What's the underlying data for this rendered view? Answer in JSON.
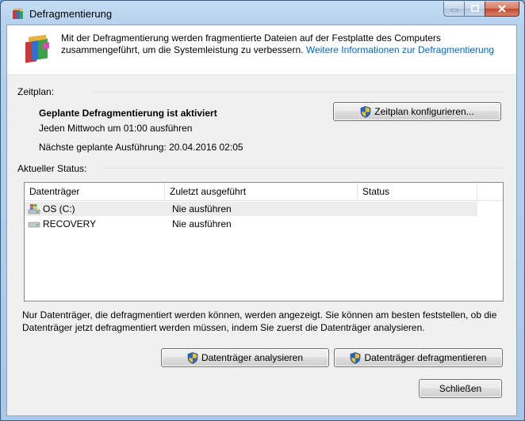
{
  "window": {
    "title": "Defragmentierung"
  },
  "intro": {
    "text": "Mit der Defragmentierung werden fragmentierte Dateien auf der Festplatte des Computers zusammengeführt, um die Systemleistung zu verbessern.",
    "link": "Weitere Informationen zur Defragmentierung"
  },
  "schedule": {
    "section_label": "Zeitplan:",
    "status": "Geplante Defragmentierung ist aktiviert",
    "frequency": "Jeden Mittwoch um 01:00 ausführen",
    "next_run": "Nächste geplante Ausführung: 20.04.2016 02:05",
    "configure_button": "Zeitplan konfigurieren..."
  },
  "status": {
    "section_label": "Aktueller Status:",
    "columns": [
      "Datenträger",
      "Zuletzt ausgeführt",
      "Status"
    ],
    "rows": [
      {
        "drive": "OS (C:)",
        "last_run": "Nie ausführen",
        "status": "",
        "selected": true
      },
      {
        "drive": "RECOVERY",
        "last_run": "Nie ausführen",
        "status": "",
        "selected": false
      }
    ]
  },
  "footer": {
    "info": "Nur Datenträger, die defragmentiert werden können, werden angezeigt. Sie können am besten feststellen, ob die Datenträger jetzt defragmentiert werden müssen, indem Sie zuerst die Datenträger analysieren.",
    "analyze_button": "Datenträger analysieren",
    "defrag_button": "Datenträger defragmentieren",
    "close_button": "Schließen"
  }
}
